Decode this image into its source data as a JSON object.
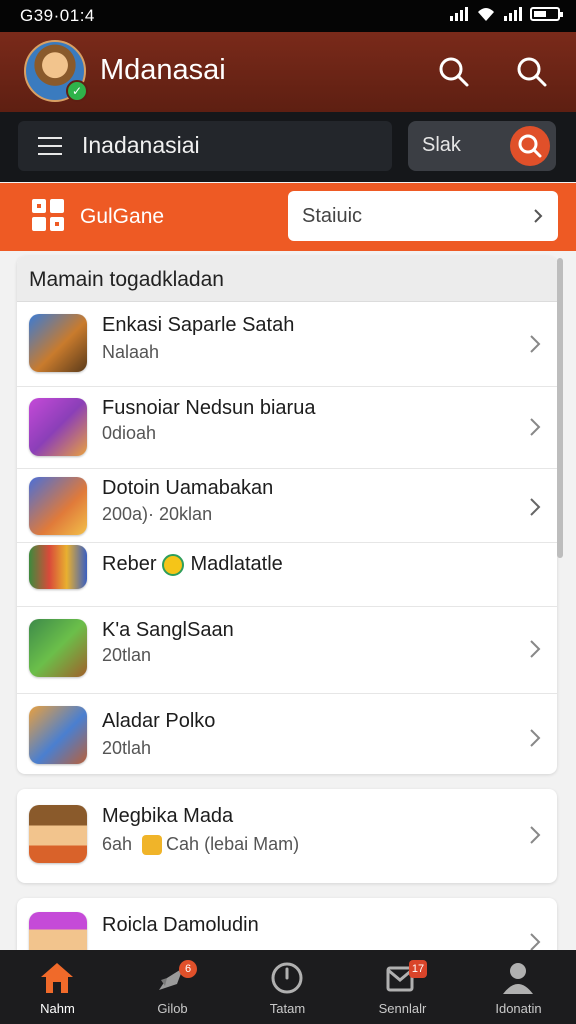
{
  "status_bar": {
    "time": "G39·01:4"
  },
  "header": {
    "title": "Mdanasai",
    "search_icon": "search-icon",
    "search_icon_alt": "search-icon"
  },
  "search": {
    "value": "Inadanasiai",
    "button_label": "Slak"
  },
  "category_bar": {
    "label": "GulGane",
    "select_value": "Staiuic"
  },
  "list_card": {
    "header": "Mamain togadkladan",
    "items": [
      {
        "title": "Enkasi Saparle Satah",
        "subtitle": "Nalaah"
      },
      {
        "title": "Fusnoiar Nedsun biarua",
        "subtitle": "0dioah"
      },
      {
        "title": "Dotoin Uamabakan",
        "subtitle": "200a)· 20klan"
      },
      {
        "title_a": "Reber",
        "title_b": "Madlatatle"
      },
      {
        "title": "K'a SanglSaan",
        "subtitle": "20tlan"
      },
      {
        "title": "Aladar Polko",
        "subtitle": "20tlah"
      }
    ]
  },
  "card2": {
    "title": "Megbika Mada",
    "sub_a": "6ah",
    "sub_b": "Cah (lebai Mam)"
  },
  "card3": {
    "title": "Roicla Damoludin"
  },
  "bottom_nav": {
    "items": [
      {
        "label": "Nahm"
      },
      {
        "label": "Gilob",
        "badge": "6"
      },
      {
        "label": "Tatam"
      },
      {
        "label": "Sennlalr",
        "badge": "17"
      },
      {
        "label": "Idonatin"
      }
    ]
  },
  "colors": {
    "header_bg": "#6b2416",
    "accent": "#ee5a24",
    "nav_active": "#f06a2a"
  }
}
